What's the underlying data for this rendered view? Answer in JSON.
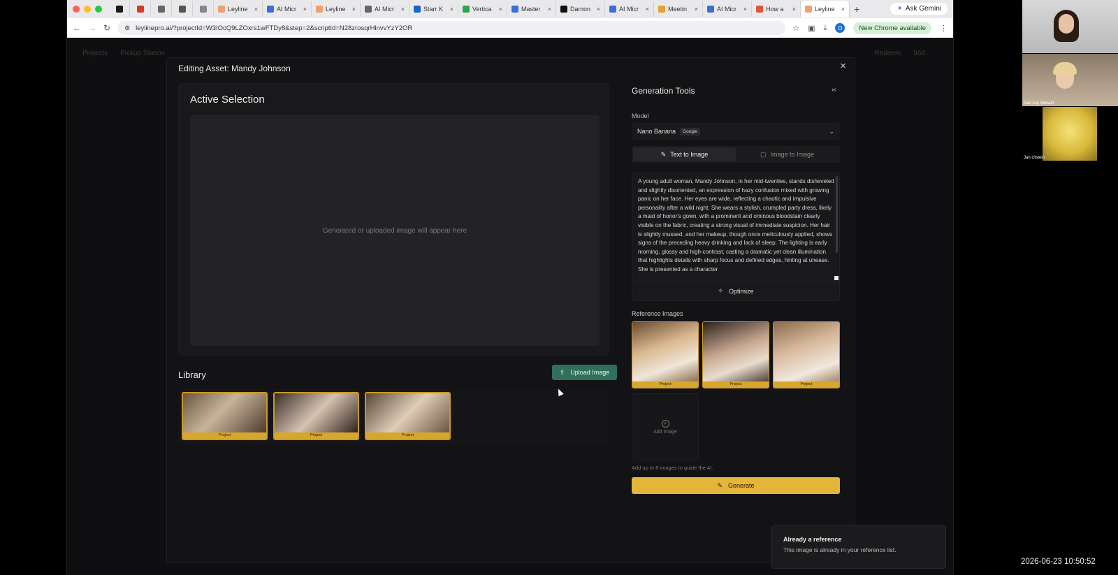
{
  "browser": {
    "tabs": [
      {
        "label": "",
        "color": "#1a1a1a"
      },
      {
        "label": "",
        "color": "#d23a2a"
      },
      {
        "label": "",
        "color": "#666"
      },
      {
        "label": "",
        "color": "#555"
      },
      {
        "label": "",
        "color": "#888"
      },
      {
        "label": "Leyline",
        "color": "#f0a070"
      },
      {
        "label": "AI Micr",
        "color": "#3b6fd6"
      },
      {
        "label": "Leyline",
        "color": "#f0a070"
      },
      {
        "label": "AI Micr",
        "color": "#666"
      },
      {
        "label": "Starr K",
        "color": "#1666c5"
      },
      {
        "label": "Vertica",
        "color": "#2da54a"
      },
      {
        "label": "Master",
        "color": "#3b6fd6"
      },
      {
        "label": "Damon",
        "color": "#111"
      },
      {
        "label": "AI Micr",
        "color": "#3b6fd6"
      },
      {
        "label": "Meetin",
        "color": "#e8a032"
      },
      {
        "label": "AI Micr",
        "color": "#3b6fd6"
      },
      {
        "label": "How a",
        "color": "#e05535"
      },
      {
        "label": "Leyline",
        "color": "#f0a070"
      }
    ],
    "ask_gemini": "Ask Gemini",
    "url": "leylinepro.ai/?projectId=W3IOcQ9LZOxrs1wFTDy8&step=2&scriptId=N28zrosqrHlnvvYzY2OR",
    "new_chrome": "New Chrome available",
    "profile_initial": "O"
  },
  "app_nav": {
    "projects": "Projects",
    "pickup": "Pickup Station",
    "redeem": "Redeem",
    "credits": "964"
  },
  "modal": {
    "title": "Editing Asset: Mandy Johnson",
    "active_selection_title": "Active Selection",
    "placeholder": "Generated or uploaded image will appear here",
    "library_title": "Library",
    "upload_label": "Upload Image",
    "library_items": [
      {
        "tag": "Project"
      },
      {
        "tag": "Project"
      },
      {
        "tag": "Project"
      }
    ]
  },
  "generation": {
    "title": "Generation Tools",
    "model_label": "Model",
    "model_value": "Nano Banana",
    "model_badge": "Google",
    "tab_text_to_image": "Text to Image",
    "tab_image_to_image": "Image to Image",
    "prompt": "A young adult woman, Mandy Johnson, in her mid-twenties, stands disheveled and slightly disoriented, an expression of hazy confusion mixed with growing panic on her face. Her eyes are wide, reflecting a chaotic and impulsive personality after a wild night. She wears a stylish, crumpled party dress, likely a maid of honor's gown, with a prominent and ominous bloodstain clearly visible on the fabric, creating a strong visual of immediate suspicion. Her hair is slightly mussed, and her makeup, though once meticulously applied, shows signs of the preceding heavy drinking and lack of sleep. The lighting is early morning, glossy and high-contrast, casting a dramatic yet clean illumination that highlights details with sharp focus and defined edges, hinting at unease. She is presented as a character",
    "optimize_label": "Optimize",
    "reference_label": "Reference Images",
    "reference_images": [
      {
        "tag": "Project"
      },
      {
        "tag": "Project"
      },
      {
        "tag": "Project"
      }
    ],
    "add_image_label": "Add Image",
    "hint": "Add up to 8 images to guide the AI.",
    "generate_label": "Generate"
  },
  "toast": {
    "title": "Already a reference",
    "message": "This image is already in your reference list."
  },
  "video": {
    "participant_2": "Gail Joy Stewart",
    "participant_3": "Jan Utstein"
  },
  "timestamp": "2026-06-23 10:50:52"
}
